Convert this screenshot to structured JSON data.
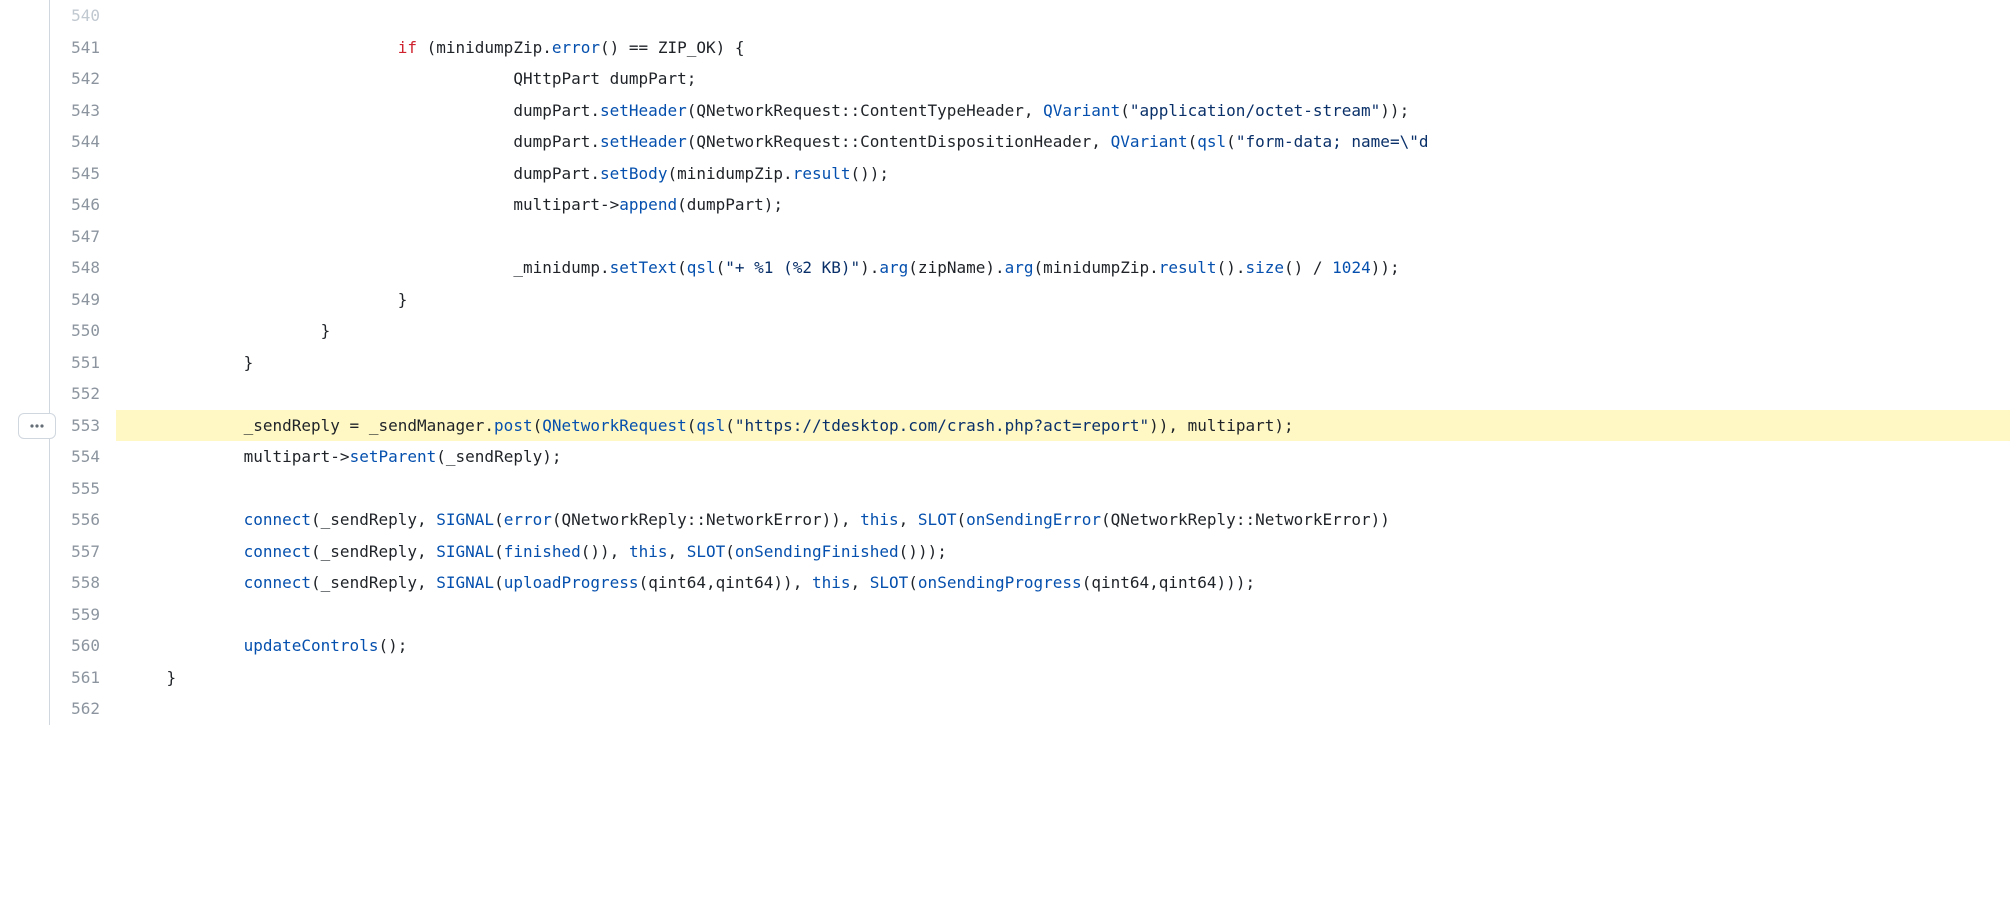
{
  "more_label": "...",
  "lines": [
    {
      "num": "540",
      "faded": true,
      "highlighted": false,
      "tokens": []
    },
    {
      "num": "541",
      "faded": false,
      "highlighted": false,
      "tokens": [
        {
          "t": "                            ",
          "c": ""
        },
        {
          "t": "if",
          "c": "kw"
        },
        {
          "t": " (minidumpZip.",
          "c": ""
        },
        {
          "t": "error",
          "c": "fn"
        },
        {
          "t": "() == ZIP_OK) {",
          "c": ""
        }
      ]
    },
    {
      "num": "542",
      "faded": false,
      "highlighted": false,
      "tokens": [
        {
          "t": "                                        QHttpPart dumpPart;",
          "c": ""
        }
      ]
    },
    {
      "num": "543",
      "faded": false,
      "highlighted": false,
      "tokens": [
        {
          "t": "                                        dumpPart.",
          "c": ""
        },
        {
          "t": "setHeader",
          "c": "fn"
        },
        {
          "t": "(QNetworkRequest::ContentTypeHeader, ",
          "c": ""
        },
        {
          "t": "QVariant",
          "c": "fn"
        },
        {
          "t": "(",
          "c": ""
        },
        {
          "t": "\"application/octet-stream\"",
          "c": "str"
        },
        {
          "t": "));",
          "c": ""
        }
      ]
    },
    {
      "num": "544",
      "faded": false,
      "highlighted": false,
      "tokens": [
        {
          "t": "                                        dumpPart.",
          "c": ""
        },
        {
          "t": "setHeader",
          "c": "fn"
        },
        {
          "t": "(QNetworkRequest::ContentDispositionHeader, ",
          "c": ""
        },
        {
          "t": "QVariant",
          "c": "fn"
        },
        {
          "t": "(",
          "c": ""
        },
        {
          "t": "qsl",
          "c": "fn"
        },
        {
          "t": "(",
          "c": ""
        },
        {
          "t": "\"form-data; name=\\\"d",
          "c": "str"
        }
      ]
    },
    {
      "num": "545",
      "faded": false,
      "highlighted": false,
      "tokens": [
        {
          "t": "                                        dumpPart.",
          "c": ""
        },
        {
          "t": "setBody",
          "c": "fn"
        },
        {
          "t": "(minidumpZip.",
          "c": ""
        },
        {
          "t": "result",
          "c": "fn"
        },
        {
          "t": "());",
          "c": ""
        }
      ]
    },
    {
      "num": "546",
      "faded": false,
      "highlighted": false,
      "tokens": [
        {
          "t": "                                        multipart->",
          "c": ""
        },
        {
          "t": "append",
          "c": "fn"
        },
        {
          "t": "(dumpPart);",
          "c": ""
        }
      ]
    },
    {
      "num": "547",
      "faded": false,
      "highlighted": false,
      "tokens": []
    },
    {
      "num": "548",
      "faded": false,
      "highlighted": false,
      "tokens": [
        {
          "t": "                                        _minidump.",
          "c": ""
        },
        {
          "t": "setText",
          "c": "fn"
        },
        {
          "t": "(",
          "c": ""
        },
        {
          "t": "qsl",
          "c": "fn"
        },
        {
          "t": "(",
          "c": ""
        },
        {
          "t": "\"+ %1 (%2 KB)\"",
          "c": "str"
        },
        {
          "t": ").",
          "c": ""
        },
        {
          "t": "arg",
          "c": "fn"
        },
        {
          "t": "(zipName).",
          "c": ""
        },
        {
          "t": "arg",
          "c": "fn"
        },
        {
          "t": "(minidumpZip.",
          "c": ""
        },
        {
          "t": "result",
          "c": "fn"
        },
        {
          "t": "().",
          "c": ""
        },
        {
          "t": "size",
          "c": "fn"
        },
        {
          "t": "() / ",
          "c": ""
        },
        {
          "t": "1024",
          "c": "num"
        },
        {
          "t": "));",
          "c": ""
        }
      ]
    },
    {
      "num": "549",
      "faded": false,
      "highlighted": false,
      "tokens": [
        {
          "t": "                            }",
          "c": ""
        }
      ]
    },
    {
      "num": "550",
      "faded": false,
      "highlighted": false,
      "tokens": [
        {
          "t": "                    }",
          "c": ""
        }
      ]
    },
    {
      "num": "551",
      "faded": false,
      "highlighted": false,
      "tokens": [
        {
          "t": "            }",
          "c": ""
        }
      ]
    },
    {
      "num": "552",
      "faded": false,
      "highlighted": false,
      "tokens": []
    },
    {
      "num": "553",
      "faded": false,
      "highlighted": true,
      "tokens": [
        {
          "t": "            _sendReply = _sendManager.",
          "c": ""
        },
        {
          "t": "post",
          "c": "fn"
        },
        {
          "t": "(",
          "c": ""
        },
        {
          "t": "QNetworkRequest",
          "c": "fn"
        },
        {
          "t": "(",
          "c": ""
        },
        {
          "t": "qsl",
          "c": "fn"
        },
        {
          "t": "(",
          "c": ""
        },
        {
          "t": "\"https://tdesktop.com/crash.php?act=report\"",
          "c": "str"
        },
        {
          "t": ")), multipart);",
          "c": ""
        }
      ]
    },
    {
      "num": "554",
      "faded": false,
      "highlighted": false,
      "tokens": [
        {
          "t": "            multipart->",
          "c": ""
        },
        {
          "t": "setParent",
          "c": "fn"
        },
        {
          "t": "(_sendReply);",
          "c": ""
        }
      ]
    },
    {
      "num": "555",
      "faded": false,
      "highlighted": false,
      "tokens": []
    },
    {
      "num": "556",
      "faded": false,
      "highlighted": false,
      "tokens": [
        {
          "t": "            ",
          "c": ""
        },
        {
          "t": "connect",
          "c": "fn"
        },
        {
          "t": "(_sendReply, ",
          "c": ""
        },
        {
          "t": "SIGNAL",
          "c": "fn"
        },
        {
          "t": "(",
          "c": ""
        },
        {
          "t": "error",
          "c": "fn"
        },
        {
          "t": "(QNetworkReply::NetworkError)), ",
          "c": ""
        },
        {
          "t": "this",
          "c": "fn"
        },
        {
          "t": ", ",
          "c": ""
        },
        {
          "t": "SLOT",
          "c": "fn"
        },
        {
          "t": "(",
          "c": ""
        },
        {
          "t": "onSendingError",
          "c": "fn"
        },
        {
          "t": "(QNetworkReply::NetworkError))",
          "c": ""
        }
      ]
    },
    {
      "num": "557",
      "faded": false,
      "highlighted": false,
      "tokens": [
        {
          "t": "            ",
          "c": ""
        },
        {
          "t": "connect",
          "c": "fn"
        },
        {
          "t": "(_sendReply, ",
          "c": ""
        },
        {
          "t": "SIGNAL",
          "c": "fn"
        },
        {
          "t": "(",
          "c": ""
        },
        {
          "t": "finished",
          "c": "fn"
        },
        {
          "t": "()), ",
          "c": ""
        },
        {
          "t": "this",
          "c": "fn"
        },
        {
          "t": ", ",
          "c": ""
        },
        {
          "t": "SLOT",
          "c": "fn"
        },
        {
          "t": "(",
          "c": ""
        },
        {
          "t": "onSendingFinished",
          "c": "fn"
        },
        {
          "t": "()));",
          "c": ""
        }
      ]
    },
    {
      "num": "558",
      "faded": false,
      "highlighted": false,
      "tokens": [
        {
          "t": "            ",
          "c": ""
        },
        {
          "t": "connect",
          "c": "fn"
        },
        {
          "t": "(_sendReply, ",
          "c": ""
        },
        {
          "t": "SIGNAL",
          "c": "fn"
        },
        {
          "t": "(",
          "c": ""
        },
        {
          "t": "uploadProgress",
          "c": "fn"
        },
        {
          "t": "(qint64,qint64)), ",
          "c": ""
        },
        {
          "t": "this",
          "c": "fn"
        },
        {
          "t": ", ",
          "c": ""
        },
        {
          "t": "SLOT",
          "c": "fn"
        },
        {
          "t": "(",
          "c": ""
        },
        {
          "t": "onSendingProgress",
          "c": "fn"
        },
        {
          "t": "(qint64,qint64)));",
          "c": ""
        }
      ]
    },
    {
      "num": "559",
      "faded": false,
      "highlighted": false,
      "tokens": []
    },
    {
      "num": "560",
      "faded": false,
      "highlighted": false,
      "tokens": [
        {
          "t": "            ",
          "c": ""
        },
        {
          "t": "updateControls",
          "c": "fn"
        },
        {
          "t": "();",
          "c": ""
        }
      ]
    },
    {
      "num": "561",
      "faded": false,
      "highlighted": false,
      "tokens": [
        {
          "t": "    }",
          "c": ""
        }
      ]
    },
    {
      "num": "562",
      "faded": false,
      "highlighted": false,
      "tokens": []
    }
  ]
}
